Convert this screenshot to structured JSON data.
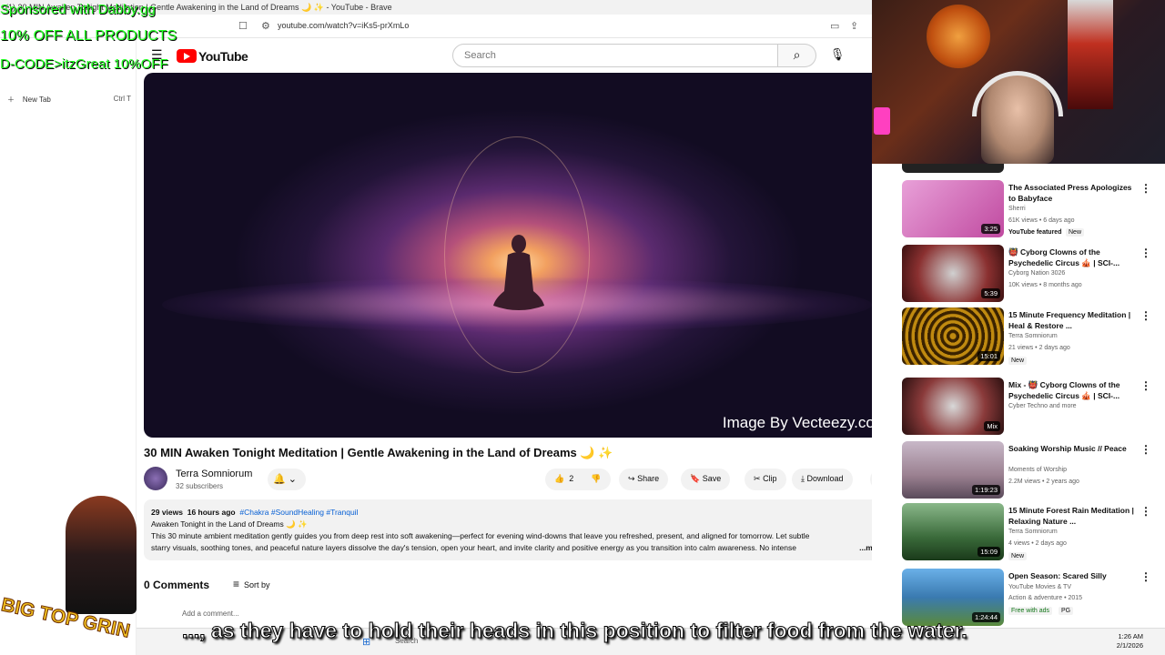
{
  "browser": {
    "tab_title": "(1) 30 MIN Awaken Tonight Meditation | Gentle Awakening in the Land of Dreams 🌙 ✨ - YouTube - Brave",
    "url": "youtube.com/watch?v=iKs5-prXmLo",
    "new_tab_label": "New Tab",
    "new_tab_shortcut": "Ctrl T"
  },
  "overlay": {
    "sponsor_line1": "Sponsored with Dabby.gg",
    "sponsor_line2": "10% OFF ALL PRODUCTS",
    "sponsor_line3": "D-CODE>itzGreat 10%OFF",
    "logo_text": "BIG TOP GRIN",
    "subtitle": "..., as they have to hold their heads in this position to filter food from the water."
  },
  "youtube": {
    "logo_text": "YouTube",
    "search_placeholder": "Search",
    "video": {
      "watermark": "Image By Vecteezy.com",
      "title": "30 MIN Awaken Tonight Meditation | Gentle Awakening in the Land of Dreams 🌙 ✨",
      "channel_name": "Terra Somniorum",
      "subscribers": "32 subscribers",
      "likes": "2",
      "share_label": "Share",
      "save_label": "Save",
      "clip_label": "Clip",
      "download_label": "Download"
    },
    "description": {
      "views": "29 views",
      "age": "16 hours ago",
      "tags": "#Chakra #SoundHealing #Tranquil",
      "line1": "Awaken Tonight in the Land of Dreams 🌙 ✨",
      "line2": "This 30 minute ambient meditation gently guides you from deep rest into soft awakening—perfect for evening wind-downs that leave you refreshed, present, and aligned for tomorrow. Let subtle",
      "line3": "starry visuals, soothing tones, and peaceful nature layers dissolve the day's tension, open your heart, and invite clarity and positive energy as you transition into calm awareness. No intense",
      "more": "...more"
    },
    "comments": {
      "count_label": "0 Comments",
      "sort_label": "Sort by",
      "add_placeholder": "Add a comment..."
    },
    "recommendations": [
      {
        "title": "The Associated Press Apologizes to Babyface",
        "channel": "Sherri",
        "meta": "61K views • 6 days ago",
        "badge": "YouTube featured",
        "badge2": "New",
        "duration": "3:25",
        "thumb_color": "#c86ab4"
      },
      {
        "title": "👹 Cyborg Clowns of the Psychedelic Circus 🎪 | SCI-...",
        "channel": "Cyborg Nation 3026",
        "meta": "10K views • 8 months ago",
        "badge": "",
        "badge2": "",
        "duration": "5:39",
        "thumb_color": "#8a3030"
      },
      {
        "title": "15 Minute Frequency Meditation | Heal & Restore ...",
        "channel": "Terra Somniorum",
        "meta": "21 views • 2 days ago",
        "badge": "New",
        "badge2": "",
        "duration": "15:01",
        "thumb_color": "#8a5a00"
      },
      {
        "title": "Mix - 👹 Cyborg Clowns of the Psychedelic Circus 🎪 | SCI-...",
        "channel": "Cyber Techno and more",
        "meta": "",
        "badge": "",
        "badge2": "",
        "duration": "Mix",
        "thumb_color": "#6a3a3a"
      },
      {
        "title": "Soaking Worship Music // Peace",
        "channel": "Moments of Worship",
        "meta": "2.2M views • 2 years ago",
        "badge": "",
        "badge2": "",
        "duration": "1:19:23",
        "thumb_color": "#9a8a9a"
      },
      {
        "title": "15 Minute Forest Rain Meditation | Relaxing Nature ...",
        "channel": "Terra Somniorum",
        "meta": "4 views • 2 days ago",
        "badge": "New",
        "badge2": "",
        "duration": "15:09",
        "thumb_color": "#3a6a3a"
      },
      {
        "title": "Open Season: Scared Silly",
        "channel": "YouTube Movies & TV",
        "meta": "Action & adventure • 2015",
        "badge": "Free with ads",
        "badge2": "PG",
        "duration": "1:24:44",
        "thumb_color": "#3a7ab0"
      }
    ]
  },
  "taskbar": {
    "search_label": "Search",
    "time": "1:26 AM",
    "date": "2/1/2026"
  }
}
